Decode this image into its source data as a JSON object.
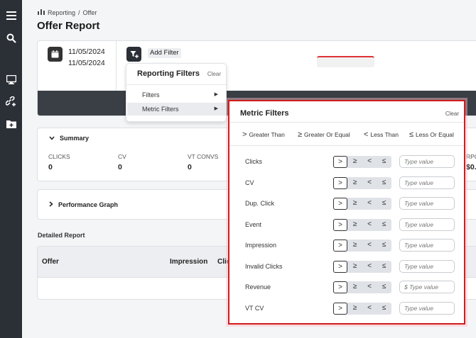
{
  "breadcrumb": {
    "root": "Reporting",
    "separator": "/",
    "current": "Offer"
  },
  "page": {
    "title": "Offer Report"
  },
  "dates": {
    "start": "11/05/2024",
    "end": "11/05/2024"
  },
  "add_filter": {
    "label": "Add Filter"
  },
  "summary": {
    "title": "Summary",
    "metrics": [
      {
        "label": "CLICKS",
        "value": "0"
      },
      {
        "label": "CV",
        "value": "0"
      },
      {
        "label": "VT CONVS",
        "value": "0"
      },
      {
        "label": "RPC",
        "value": "$0."
      }
    ]
  },
  "performance": {
    "title": "Performance Graph"
  },
  "detailed": {
    "title": "Detailed Report",
    "columns": [
      "Offer",
      "Impression",
      "Clic"
    ]
  },
  "reporting_filters": {
    "title": "Reporting Filters",
    "clear": "Clear",
    "items": [
      {
        "label": "Filters",
        "arrow": "▶"
      },
      {
        "label": "Metric Filters",
        "arrow": "▶"
      }
    ]
  },
  "metric_filters": {
    "title": "Metric Filters",
    "clear": "Clear",
    "legend": [
      {
        "symbol": ">",
        "label": "Greater Than"
      },
      {
        "symbol": "≥",
        "label": "Greater Or Equal"
      },
      {
        "symbol": "<",
        "label": "Less Than"
      },
      {
        "symbol": "≤",
        "label": "Less Or Equal"
      }
    ],
    "operators": [
      ">",
      "≥",
      "<",
      "≤"
    ],
    "rows": [
      {
        "label": "Clicks",
        "placeholder": "Type value"
      },
      {
        "label": "CV",
        "placeholder": "Type value"
      },
      {
        "label": "Dup. Click",
        "placeholder": "Type value"
      },
      {
        "label": "Event",
        "placeholder": "Type value"
      },
      {
        "label": "Impression",
        "placeholder": "Type value"
      },
      {
        "label": "Invalid Clicks",
        "placeholder": "Type value"
      },
      {
        "label": "Revenue",
        "placeholder": "$ Type value"
      },
      {
        "label": "VT CV",
        "placeholder": "Type value"
      }
    ]
  },
  "colors": {
    "sidebar": "#2b2f36",
    "highlight": "#d01c1c",
    "band": "#3a3e45"
  }
}
